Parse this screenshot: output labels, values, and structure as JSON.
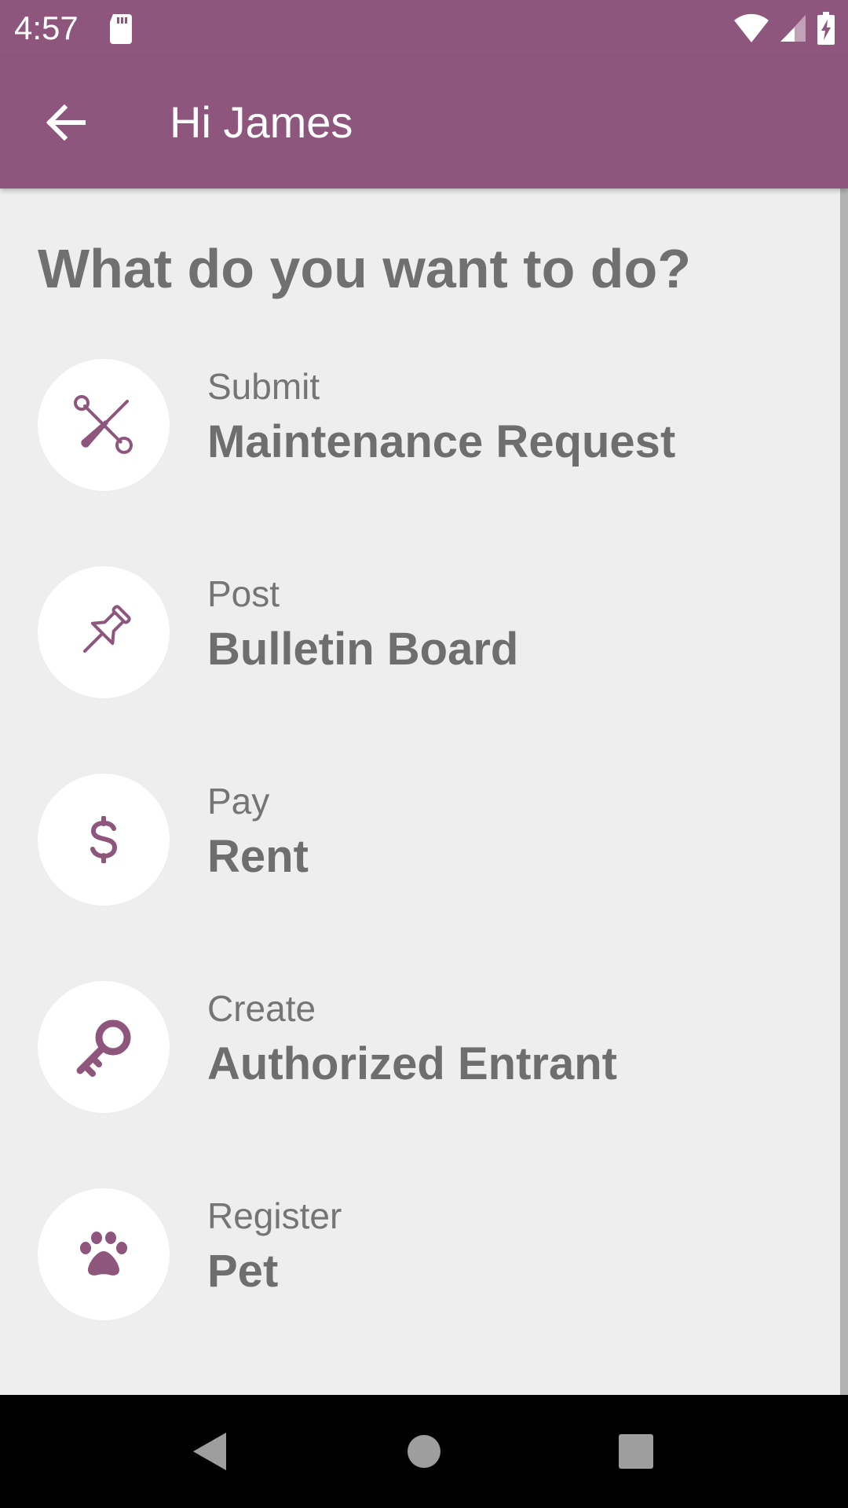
{
  "status_bar": {
    "time": "4:57"
  },
  "app_bar": {
    "title": "Hi James",
    "back_icon": "arrow-left-icon"
  },
  "content": {
    "heading": "What do you want to do?",
    "actions": [
      {
        "verb": "Submit",
        "title": "Maintenance Request",
        "icon": "tools-icon"
      },
      {
        "verb": "Post",
        "title": "Bulletin Board",
        "icon": "pushpin-icon"
      },
      {
        "verb": "Pay",
        "title": "Rent",
        "icon": "dollar-icon"
      },
      {
        "verb": "Create",
        "title": "Authorized Entrant",
        "icon": "key-icon"
      },
      {
        "verb": "Register",
        "title": "Pet",
        "icon": "paw-icon"
      }
    ]
  },
  "colors": {
    "primary": "#8e567d",
    "icon": "#8e567d",
    "background": "#eeeeee",
    "text": "#707070"
  },
  "nav_bar": {
    "back_icon": "nav-back-icon",
    "home_icon": "nav-home-icon",
    "recents_icon": "nav-recents-icon"
  }
}
